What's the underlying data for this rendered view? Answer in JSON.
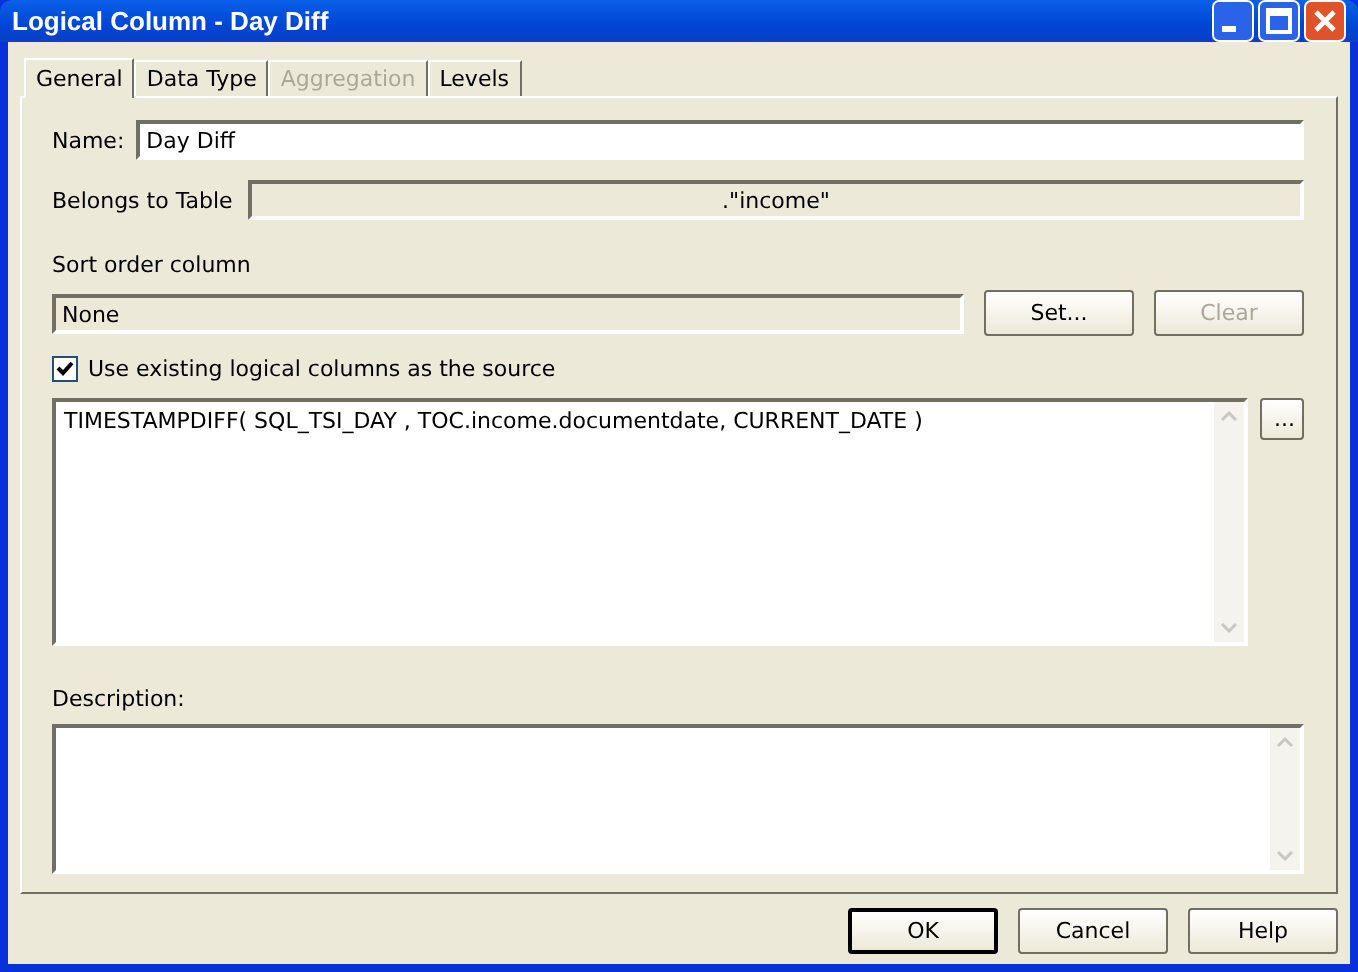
{
  "window": {
    "title": "Logical Column - Day Diff"
  },
  "tabs": [
    {
      "label": "General",
      "selected": true,
      "disabled": false
    },
    {
      "label": "Data Type",
      "selected": false,
      "disabled": false
    },
    {
      "label": "Aggregation",
      "selected": false,
      "disabled": true
    },
    {
      "label": "Levels",
      "selected": false,
      "disabled": false
    }
  ],
  "name": {
    "label": "Name:",
    "value": "Day Diff"
  },
  "belongs_to_table": {
    "label": "Belongs to Table",
    "value": ".\"income\""
  },
  "sort_order_column": {
    "label": "Sort order column",
    "value": "None",
    "buttons": [
      {
        "label": "Set...",
        "disabled": false
      },
      {
        "label": "Clear",
        "disabled": true
      }
    ]
  },
  "use_existing": {
    "label": "Use existing logical columns as the source",
    "checked": true
  },
  "expression": {
    "value": "TIMESTAMPDIFF( SQL_TSI_DAY , TOC.income.documentdate,  CURRENT_DATE )",
    "browse_button": "..."
  },
  "description": {
    "label": "Description:"
  },
  "buttons": [
    {
      "label": "OK",
      "default": true
    },
    {
      "label": "Cancel",
      "default": false
    },
    {
      "label": "Help",
      "default": false
    }
  ]
}
